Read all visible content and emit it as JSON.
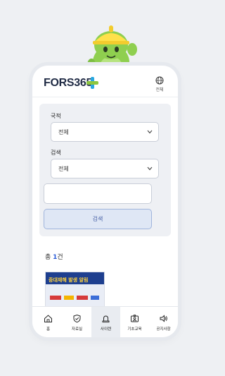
{
  "header": {
    "logo_text": "FORS365",
    "language_label": "전체",
    "logo_icon": "plus-cross-icon",
    "language_icon": "globe-icon"
  },
  "filters": {
    "nationality": {
      "label": "국적",
      "value": "전체"
    },
    "search_type": {
      "label": "검색",
      "value": "전체"
    },
    "keyword": {
      "value": "",
      "placeholder": ""
    },
    "search_button": "검색"
  },
  "results": {
    "prefix": "총",
    "count": "1",
    "suffix": "건",
    "items": [
      {
        "title": "중대재해 발생 알림",
        "thumbnail_icon": "accident-alert-thumbnail"
      }
    ]
  },
  "tabs": [
    {
      "label": "홈",
      "icon": "home-icon",
      "active": false
    },
    {
      "label": "자료실",
      "icon": "shield-icon",
      "active": false
    },
    {
      "label": "사이렌",
      "icon": "siren-icon",
      "active": true
    },
    {
      "label": "기초교육",
      "icon": "id-card-icon",
      "active": false
    },
    {
      "label": "공지사항",
      "icon": "speaker-icon",
      "active": false
    }
  ],
  "colors": {
    "brand_navy": "#1f2a44",
    "accent_blue": "#2a5bd7",
    "plus_green": "#8cc63f",
    "plus_blue": "#29a8e0",
    "mascot_green": "#8fcf4f",
    "helmet_yellow": "#ffe14a"
  }
}
